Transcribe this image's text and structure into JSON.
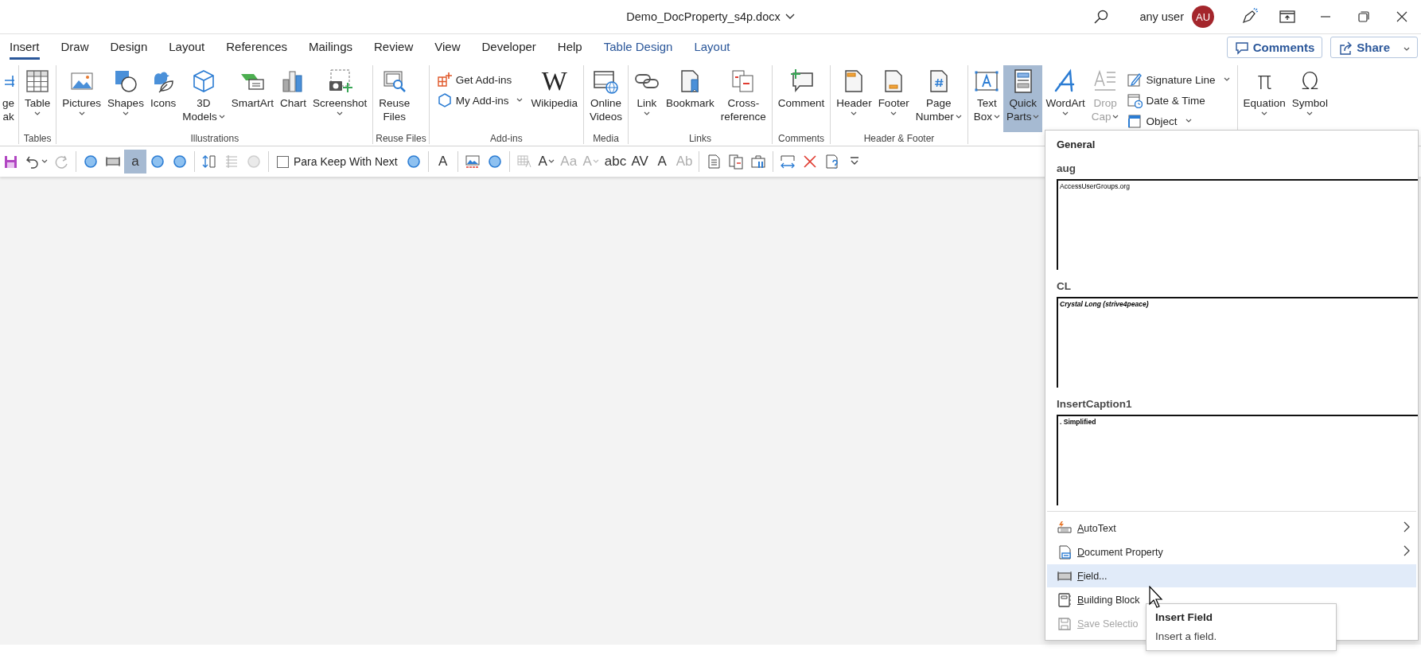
{
  "window": {
    "title": "Demo_DocProperty_s4p.docx",
    "user": "any user",
    "avatar_initials": "AU"
  },
  "tabs": [
    {
      "label": "Insert",
      "selected": true,
      "contextual": false
    },
    {
      "label": "Draw",
      "selected": false,
      "contextual": false
    },
    {
      "label": "Design",
      "selected": false,
      "contextual": false
    },
    {
      "label": "Layout",
      "selected": false,
      "contextual": false
    },
    {
      "label": "References",
      "selected": false,
      "contextual": false
    },
    {
      "label": "Mailings",
      "selected": false,
      "contextual": false
    },
    {
      "label": "Review",
      "selected": false,
      "contextual": false
    },
    {
      "label": "View",
      "selected": false,
      "contextual": false
    },
    {
      "label": "Developer",
      "selected": false,
      "contextual": false
    },
    {
      "label": "Help",
      "selected": false,
      "contextual": false
    },
    {
      "label": "Table Design",
      "selected": false,
      "contextual": true
    },
    {
      "label": "Layout",
      "selected": false,
      "contextual": true
    }
  ],
  "header_buttons": [
    {
      "label": "Comments",
      "dropdown": false
    },
    {
      "label": "Share",
      "dropdown": true
    }
  ],
  "ribbon": {
    "groups": [
      {
        "controls": [
          {
            "kind": "large",
            "label": "ge\nak",
            "dropdown": false,
            "disabled": false,
            "expanded": false
          }
        ]
      },
      {
        "label": "Tables",
        "controls": [
          {
            "kind": "large",
            "label": "Table",
            "dropdown": true,
            "disabled": false,
            "expanded": false
          }
        ]
      },
      {
        "label": "Illustrations",
        "controls": [
          {
            "kind": "large",
            "label": "Pictures",
            "dropdown": true,
            "disabled": false,
            "expanded": false
          },
          {
            "kind": "large",
            "label": "Shapes",
            "dropdown": true,
            "disabled": false,
            "expanded": false
          },
          {
            "kind": "large",
            "label": "Icons",
            "dropdown": false,
            "disabled": false,
            "expanded": false
          },
          {
            "kind": "large",
            "label": "3D\nModels",
            "dropdown": true,
            "disabled": false,
            "expanded": false
          },
          {
            "kind": "large",
            "label": "SmartArt",
            "dropdown": false,
            "disabled": false,
            "expanded": false
          },
          {
            "kind": "large",
            "label": "Chart",
            "dropdown": false,
            "disabled": false,
            "expanded": false
          },
          {
            "kind": "large",
            "label": "Screenshot",
            "dropdown": true,
            "disabled": false,
            "expanded": false
          }
        ]
      },
      {
        "label": "Reuse Files",
        "controls": [
          {
            "kind": "large",
            "label": "Reuse\nFiles",
            "dropdown": false,
            "disabled": false,
            "expanded": false
          }
        ]
      },
      {
        "label": "Add-ins",
        "controls": [
          {
            "kind": "stack",
            "items": [
              {
                "label": "Get Add-ins",
                "dropdown": false,
                "disabled": false
              },
              {
                "label": "My Add-ins",
                "dropdown": true,
                "disabled": false
              }
            ]
          },
          {
            "kind": "large",
            "label": "Wikipedia",
            "glyph": "W",
            "dropdown": false,
            "disabled": false,
            "expanded": false
          }
        ]
      },
      {
        "label": "Media",
        "controls": [
          {
            "kind": "large",
            "label": "Online\nVideos",
            "dropdown": false,
            "disabled": false,
            "expanded": false
          }
        ]
      },
      {
        "label": "Links",
        "controls": [
          {
            "kind": "large",
            "label": "Link",
            "dropdown": true,
            "disabled": false,
            "expanded": false
          },
          {
            "kind": "large",
            "label": "Bookmark",
            "dropdown": false,
            "disabled": false,
            "expanded": false
          },
          {
            "kind": "large",
            "label": "Cross-\nreference",
            "dropdown": false,
            "disabled": false,
            "expanded": false
          }
        ]
      },
      {
        "label": "Comments",
        "controls": [
          {
            "kind": "large",
            "label": "Comment",
            "dropdown": false,
            "disabled": false,
            "expanded": false
          }
        ]
      },
      {
        "label": "Header & Footer",
        "controls": [
          {
            "kind": "large",
            "label": "Header",
            "dropdown": true,
            "disabled": false,
            "expanded": false
          },
          {
            "kind": "large",
            "label": "Footer",
            "dropdown": true,
            "disabled": false,
            "expanded": false
          },
          {
            "kind": "large",
            "label": "Page\nNumber",
            "dropdown": true,
            "disabled": false,
            "expanded": false
          }
        ]
      },
      {
        "controls": [
          {
            "kind": "large",
            "label": "Text\nBox",
            "dropdown": true,
            "disabled": false,
            "expanded": false
          },
          {
            "kind": "large",
            "label": "Quick\nParts",
            "dropdown": true,
            "disabled": false,
            "expanded": true
          },
          {
            "kind": "large",
            "label": "WordArt",
            "dropdown": true,
            "disabled": false,
            "expanded": false
          },
          {
            "kind": "large",
            "label": "Drop\nCap",
            "dropdown": true,
            "disabled": true,
            "expanded": false
          },
          {
            "kind": "stack",
            "items": [
              {
                "label": "Signature Line",
                "dropdown": true,
                "disabled": false
              },
              {
                "label": "Date & Time",
                "dropdown": false,
                "disabled": false
              },
              {
                "label": "Object",
                "dropdown": true,
                "disabled": false
              }
            ]
          }
        ]
      },
      {
        "controls": [
          {
            "kind": "large",
            "label": "Equation",
            "glyph": "π",
            "dropdown": true,
            "disabled": false,
            "expanded": false
          },
          {
            "kind": "large",
            "label": "Symbol",
            "glyph": "Ω",
            "dropdown": true,
            "disabled": false,
            "expanded": false
          }
        ]
      }
    ]
  },
  "quick_access_toolbar": [
    {
      "kind": "button",
      "disabled": false,
      "pressed": false,
      "dropdown": false
    },
    {
      "kind": "button",
      "disabled": false,
      "pressed": false,
      "dropdown": true
    },
    {
      "kind": "button",
      "disabled": true,
      "pressed": false,
      "dropdown": false
    },
    {
      "kind": "separator"
    },
    {
      "kind": "button",
      "disabled": false,
      "pressed": false,
      "dropdown": false
    },
    {
      "kind": "button",
      "disabled": false,
      "pressed": false,
      "dropdown": false
    },
    {
      "kind": "button",
      "glyph": "a",
      "disabled": false,
      "pressed": true,
      "dropdown": false
    },
    {
      "kind": "button",
      "disabled": false,
      "pressed": false,
      "dropdown": false
    },
    {
      "kind": "button",
      "disabled": false,
      "pressed": false,
      "dropdown": false
    },
    {
      "kind": "separator"
    },
    {
      "kind": "button",
      "disabled": false,
      "pressed": false,
      "dropdown": false
    },
    {
      "kind": "button",
      "disabled": true,
      "pressed": false,
      "dropdown": false
    },
    {
      "kind": "button",
      "disabled": true,
      "pressed": false,
      "dropdown": false
    },
    {
      "kind": "separator"
    },
    {
      "kind": "checkbox",
      "label": "Para Keep With Next",
      "checked": false
    },
    {
      "kind": "button",
      "disabled": false,
      "pressed": false,
      "dropdown": false
    },
    {
      "kind": "separator"
    },
    {
      "kind": "button",
      "glyph": "A",
      "disabled": false,
      "pressed": false,
      "dropdown": false
    },
    {
      "kind": "separator"
    },
    {
      "kind": "button",
      "disabled": false,
      "pressed": false,
      "dropdown": false
    },
    {
      "kind": "button",
      "disabled": false,
      "pressed": false,
      "dropdown": false
    },
    {
      "kind": "separator"
    },
    {
      "kind": "button",
      "disabled": true,
      "pressed": false,
      "dropdown": false
    },
    {
      "kind": "button",
      "glyph": "A",
      "disabled": false,
      "pressed": false,
      "dropdown": true
    },
    {
      "kind": "button",
      "glyph": "Aa",
      "disabled": true,
      "pressed": false,
      "dropdown": false
    },
    {
      "kind": "button",
      "glyph": "A",
      "disabled": true,
      "pressed": false,
      "dropdown": true
    },
    {
      "kind": "button",
      "glyph": "abc",
      "disabled": false,
      "pressed": false,
      "dropdown": false
    },
    {
      "kind": "button",
      "glyph": "AV",
      "disabled": false,
      "pressed": false,
      "dropdown": false
    },
    {
      "kind": "button",
      "glyph": "A",
      "disabled": false,
      "pressed": false,
      "dropdown": false
    },
    {
      "kind": "button",
      "glyph": "Ab",
      "disabled": true,
      "pressed": false,
      "dropdown": false
    },
    {
      "kind": "separator"
    },
    {
      "kind": "button",
      "disabled": false,
      "pressed": false,
      "dropdown": false
    },
    {
      "kind": "button",
      "disabled": false,
      "pressed": false,
      "dropdown": false
    },
    {
      "kind": "button",
      "disabled": false,
      "pressed": false,
      "dropdown": false
    },
    {
      "kind": "separator"
    },
    {
      "kind": "button",
      "disabled": false,
      "pressed": false,
      "dropdown": false
    },
    {
      "kind": "button",
      "disabled": false,
      "pressed": false,
      "dropdown": false
    },
    {
      "kind": "button",
      "disabled": false,
      "pressed": false,
      "dropdown": false
    },
    {
      "kind": "button",
      "disabled": false,
      "pressed": false,
      "dropdown": false
    }
  ],
  "quick_parts_menu": {
    "heading": "General",
    "entries": [
      {
        "name": "aug",
        "preview": "AccessUserGroups.org",
        "kind": "plain"
      },
      {
        "name": "CL",
        "preview": "Crystal Long (strive4peace)",
        "kind": "italic"
      },
      {
        "name": "InsertCaption1",
        "preview": ". Simplified",
        "kind": "bold"
      }
    ],
    "commands": [
      {
        "label": "AutoText",
        "submenu": true,
        "hovered": false,
        "disabled": false
      },
      {
        "label": "Document Property",
        "submenu": true,
        "hovered": false,
        "disabled": false
      },
      {
        "label": "Field...",
        "submenu": false,
        "hovered": true,
        "disabled": false
      },
      {
        "label": "Building Block",
        "submenu": false,
        "hovered": false,
        "disabled": false
      },
      {
        "label": "Save Selectio",
        "submenu": false,
        "hovered": false,
        "disabled": true
      }
    ]
  },
  "tooltip": {
    "title": "Insert Field",
    "description": "Insert a field."
  }
}
